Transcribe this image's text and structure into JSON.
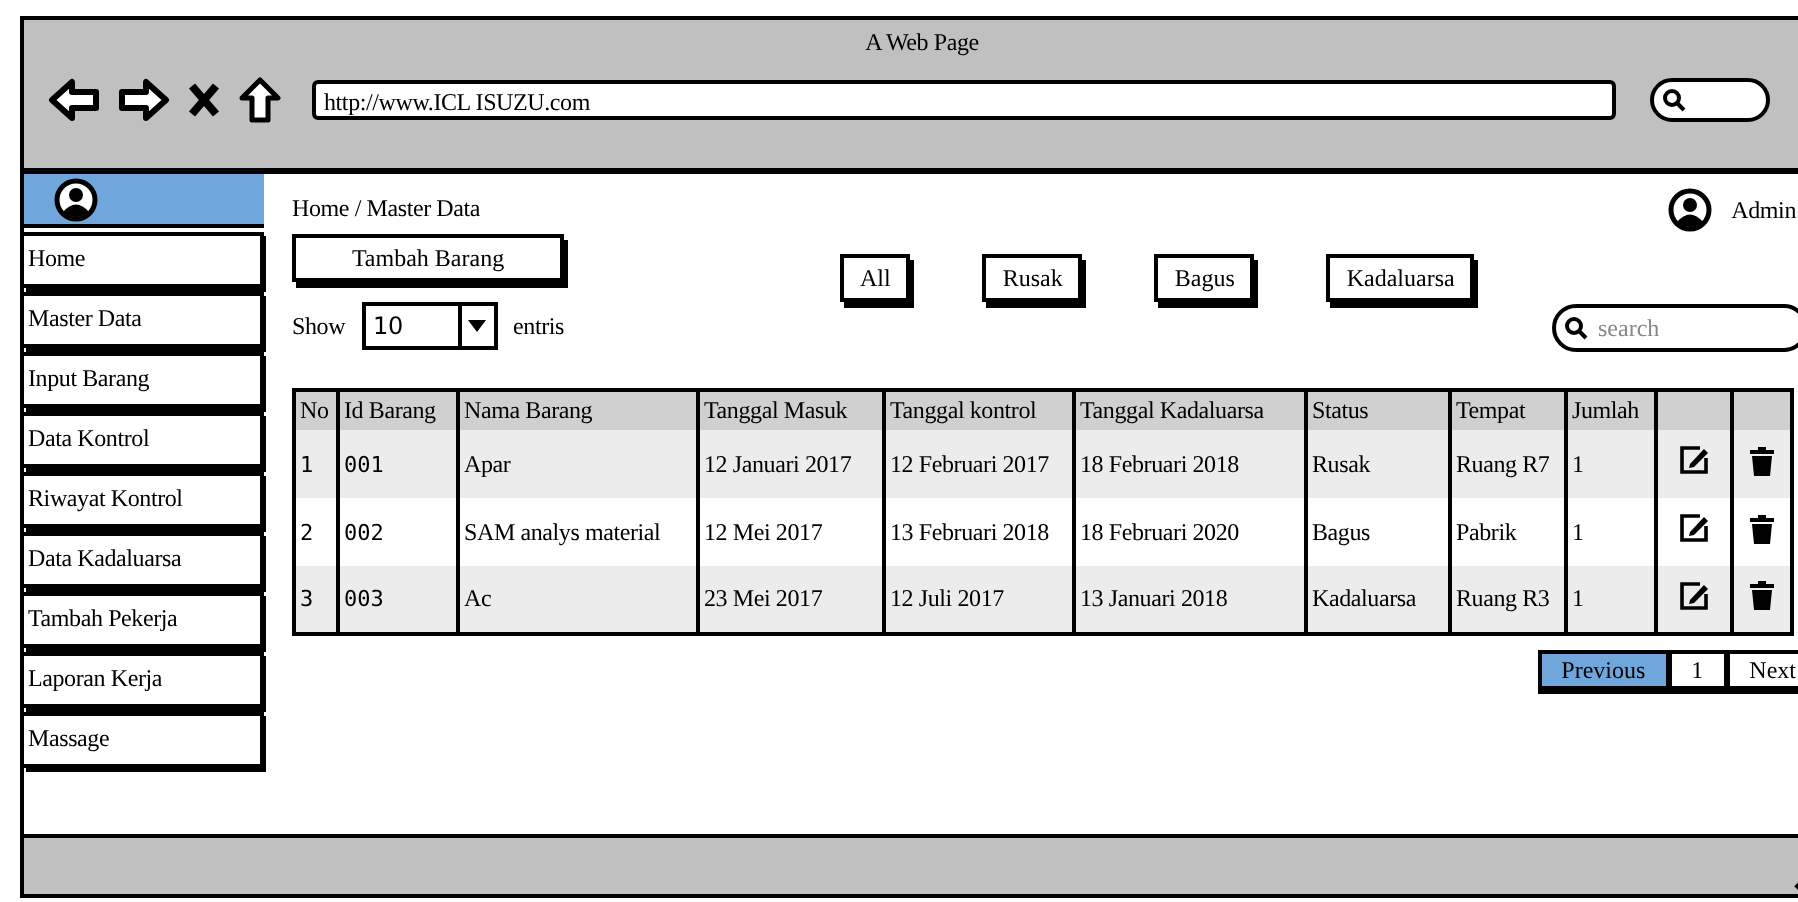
{
  "window": {
    "title": "A Web Page"
  },
  "browser": {
    "url": "http://www.ICL ISUZU.com"
  },
  "sidebar": {
    "items": [
      "Home",
      "Master Data",
      "Input Barang",
      "Data Kontrol",
      "Riwayat Kontrol",
      "Data Kadaluarsa",
      "Tambah Pekerja",
      "Laporan Kerja",
      "Massage"
    ]
  },
  "breadcrumb": "Home / Master Data",
  "user": {
    "name": "Admin"
  },
  "add_button": "Tambah Barang",
  "filters": [
    "All",
    "Rusak",
    "Bagus",
    "Kadaluarsa"
  ],
  "page_size": {
    "label": "Show",
    "value": "10",
    "suffix": "entris"
  },
  "search": {
    "placeholder": "search"
  },
  "table": {
    "columns": [
      "No",
      "Id Barang",
      "Nama Barang",
      "Tanggal Masuk",
      "Tanggal kontrol",
      "Tanggal Kadaluarsa",
      "Status",
      "Tempat",
      "Jumlah"
    ],
    "rows": [
      {
        "cells": [
          "1",
          "001",
          "Apar",
          "12 Januari 2017",
          "12 Februari 2017",
          "18 Februari 2018",
          "Rusak",
          "Ruang R7",
          "1"
        ]
      },
      {
        "cells": [
          "2",
          "002",
          "SAM analys material",
          "12 Mei 2017",
          "13 Februari 2018",
          "18 Februari 2020",
          "Bagus",
          "Pabrik",
          "1"
        ]
      },
      {
        "cells": [
          "3",
          "003",
          "Ac",
          "23 Mei 2017",
          "12 Juli 2017",
          "13 Januari 2018",
          "Kadaluarsa",
          "Ruang R3",
          "1"
        ]
      }
    ]
  },
  "pagination": [
    {
      "label": "Previous",
      "selected": true
    },
    {
      "label": "1",
      "selected": false
    },
    {
      "label": "Next",
      "selected": false
    }
  ]
}
